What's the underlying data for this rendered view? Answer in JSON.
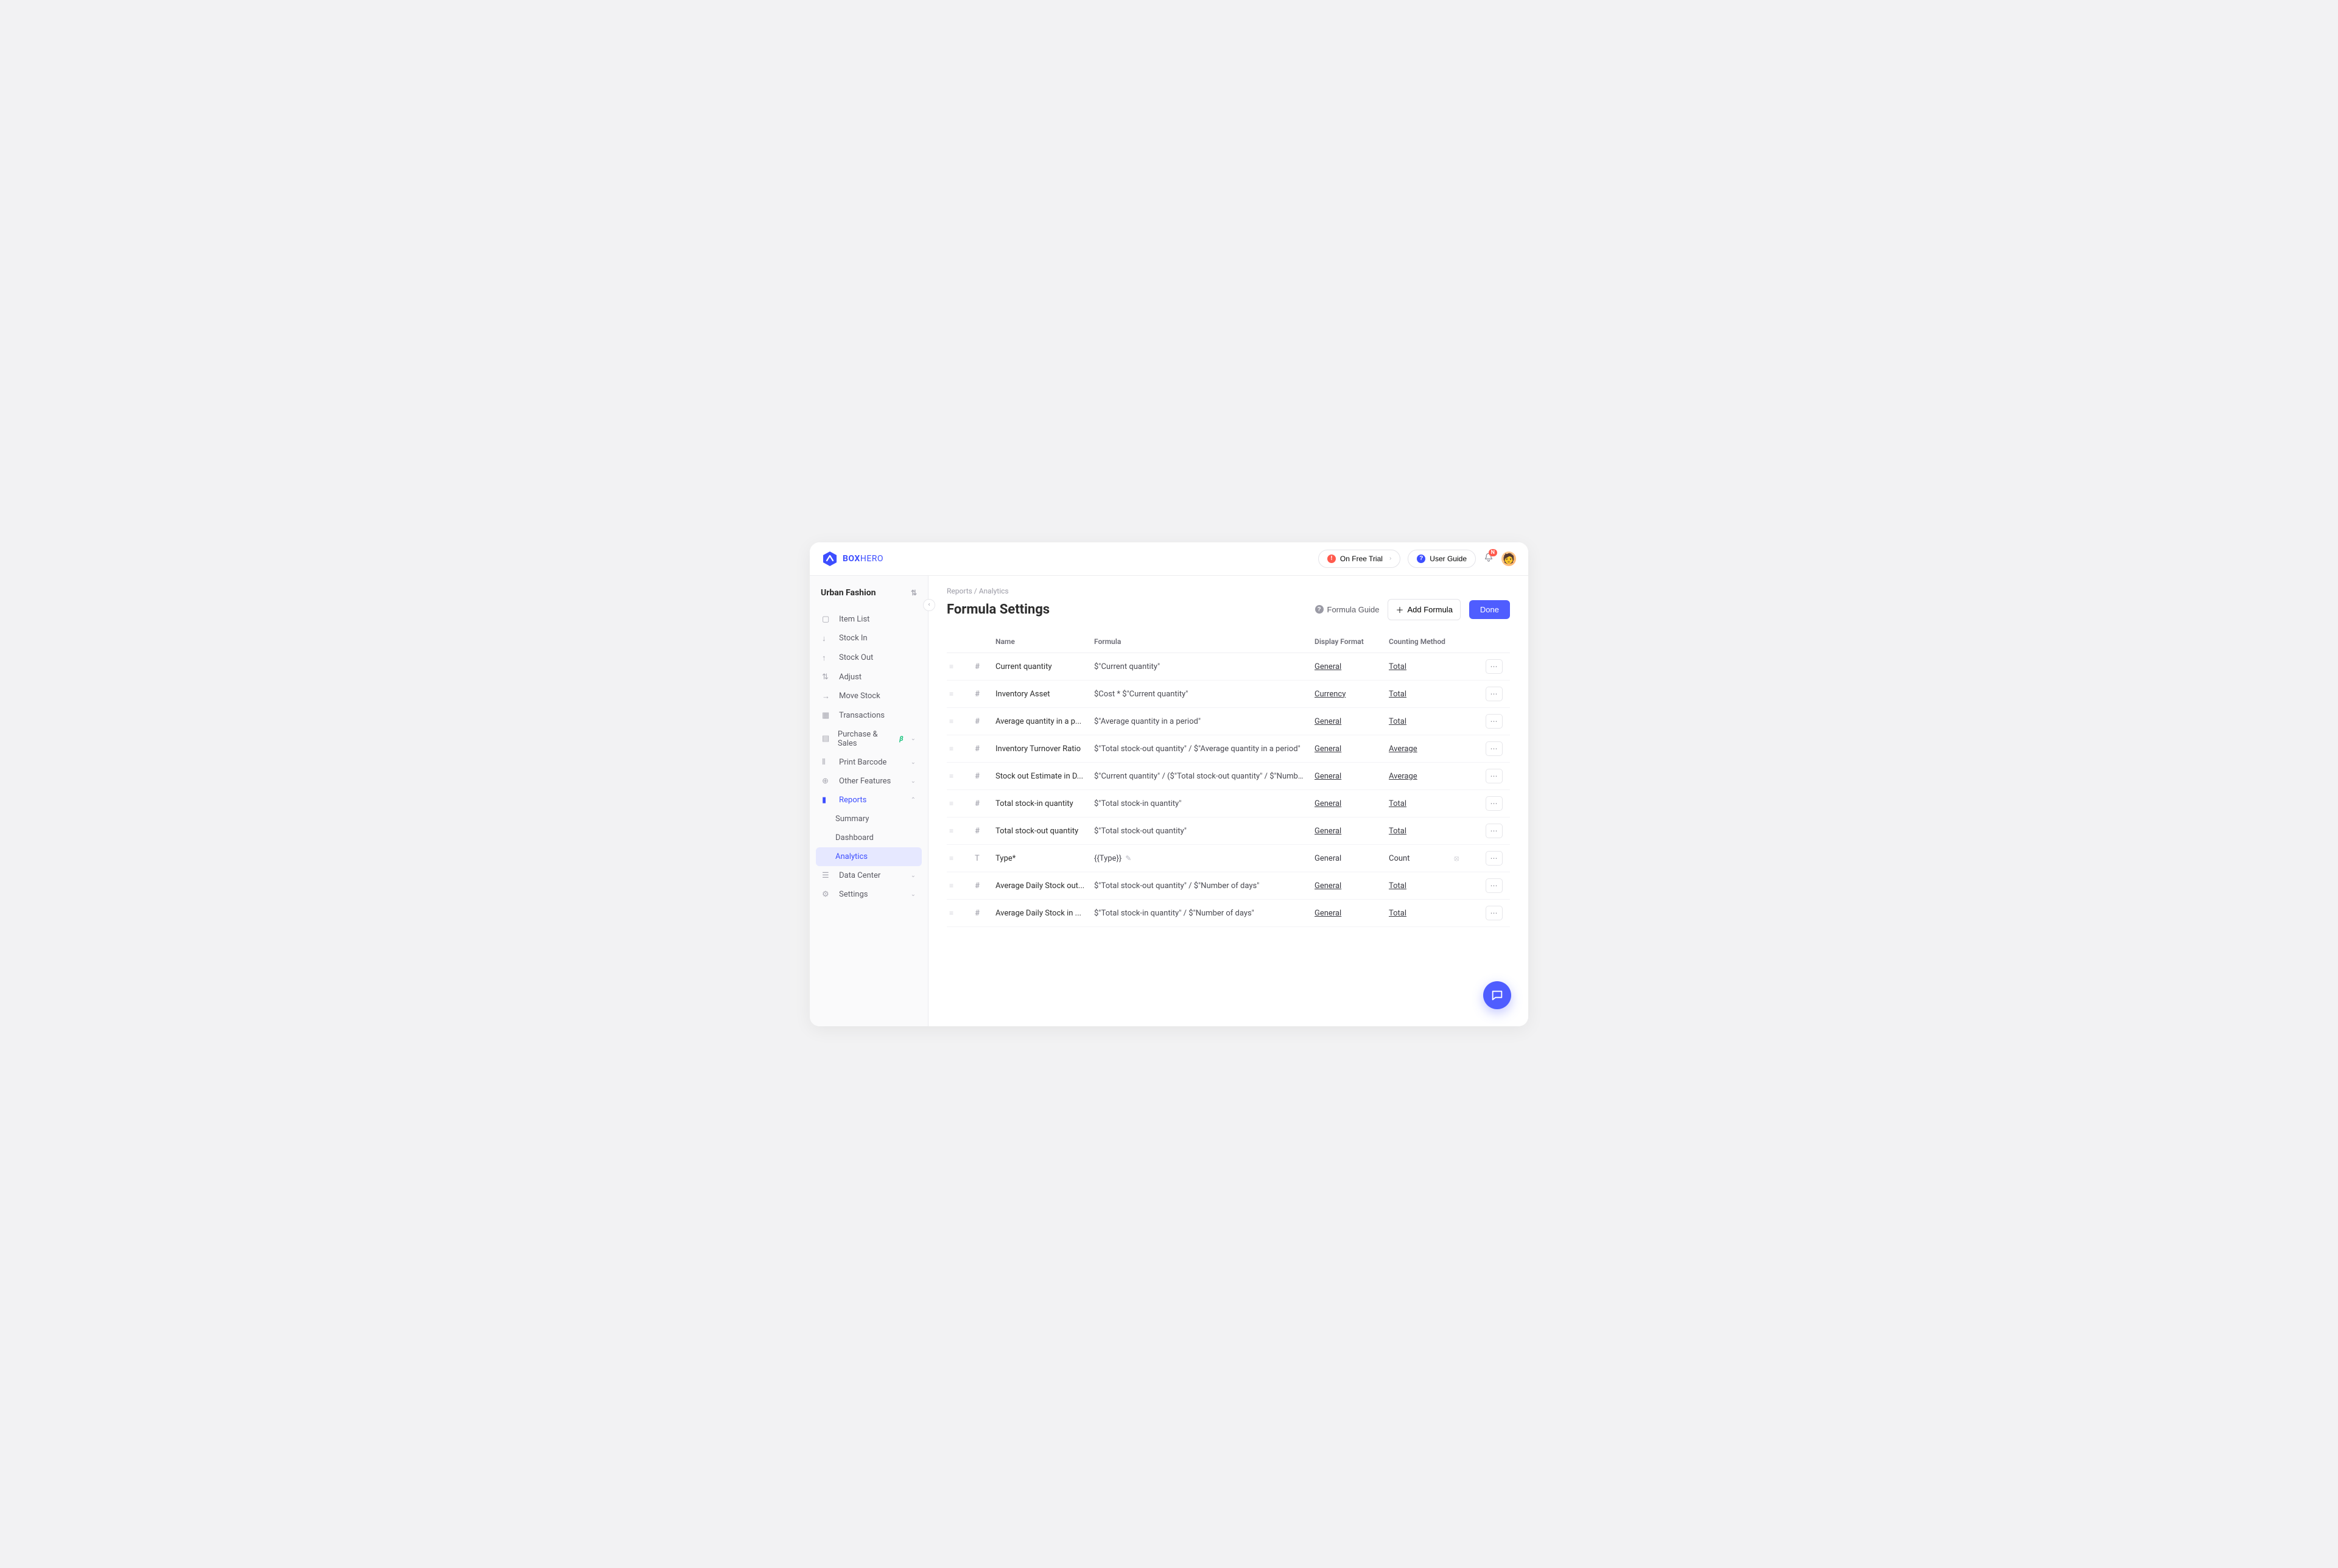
{
  "brand": {
    "bold": "BOX",
    "light": "HERO"
  },
  "topbar": {
    "trial_label": "On Free Trial",
    "guide_label": "User Guide",
    "notif_count": "N"
  },
  "team": {
    "name": "Urban Fashion"
  },
  "sidebar": {
    "items": [
      {
        "label": "Item List",
        "icon": "box"
      },
      {
        "label": "Stock In",
        "icon": "down"
      },
      {
        "label": "Stock Out",
        "icon": "up"
      },
      {
        "label": "Adjust",
        "icon": "swap"
      },
      {
        "label": "Move Stock",
        "icon": "arrow"
      },
      {
        "label": "Transactions",
        "icon": "receipt"
      },
      {
        "label": "Purchase & Sales",
        "icon": "doc",
        "beta": true,
        "expandable": true
      },
      {
        "label": "Print Barcode",
        "icon": "barcode",
        "expandable": true
      },
      {
        "label": "Other Features",
        "icon": "plus-circle",
        "expandable": true
      },
      {
        "label": "Reports",
        "icon": "chart",
        "highlight": true,
        "expanded": true
      },
      {
        "label": "Summary",
        "sub": true
      },
      {
        "label": "Dashboard",
        "sub": true
      },
      {
        "label": "Analytics",
        "sub": true,
        "active": true
      },
      {
        "label": "Data Center",
        "icon": "data",
        "expandable": true
      },
      {
        "label": "Settings",
        "icon": "gear",
        "expandable": true
      }
    ]
  },
  "breadcrumb": "Reports  /  Analytics",
  "page_title": "Formula Settings",
  "actions": {
    "guide": "Formula Guide",
    "add": "Add Formula",
    "done": "Done"
  },
  "columns": {
    "name": "Name",
    "formula": "Formula",
    "display": "Display Format",
    "counting": "Counting Method"
  },
  "rows": [
    {
      "type": "#",
      "name": "Current quantity",
      "formula": "$\"Current quantity\"",
      "display": "General",
      "display_link": true,
      "count": "Total",
      "count_link": true
    },
    {
      "type": "#",
      "name": "Inventory Asset",
      "formula": "$Cost * $\"Current quantity\"",
      "display": "Currency",
      "display_link": true,
      "count": "Total",
      "count_link": true
    },
    {
      "type": "#",
      "name": "Average quantity in a p...",
      "formula": "$\"Average quantity in a period\"",
      "display": "General",
      "display_link": true,
      "count": "Total",
      "count_link": true
    },
    {
      "type": "#",
      "name": "Inventory Turnover Ratio",
      "formula": "$\"Total stock-out quantity\" / $\"Average quantity in a period\"",
      "display": "General",
      "display_link": true,
      "count": "Average",
      "count_link": true
    },
    {
      "type": "#",
      "name": "Stock out Estimate in D...",
      "formula": "$\"Current quantity\" / ($\"Total stock-out quantity\" / $\"Number of day...",
      "display": "General",
      "display_link": true,
      "count": "Average",
      "count_link": true
    },
    {
      "type": "#",
      "name": "Total stock-in quantity",
      "formula": "$\"Total stock-in quantity\"",
      "display": "General",
      "display_link": true,
      "count": "Total",
      "count_link": true
    },
    {
      "type": "#",
      "name": "Total stock-out quantity",
      "formula": "$\"Total stock-out quantity\"",
      "display": "General",
      "display_link": true,
      "count": "Total",
      "count_link": true
    },
    {
      "type": "T",
      "name": "Type*",
      "formula": "{{Type}}",
      "editable": true,
      "display": "General",
      "display_link": false,
      "count": "Count",
      "count_link": false,
      "hidden": true
    },
    {
      "type": "#",
      "name": "Average Daily Stock out...",
      "formula": "$\"Total stock-out quantity\" / $\"Number of days\"",
      "display": "General",
      "display_link": true,
      "count": "Total",
      "count_link": true
    },
    {
      "type": "#",
      "name": "Average Daily Stock in ...",
      "formula": "$\"Total stock-in quantity\" / $\"Number of days\"",
      "display": "General",
      "display_link": true,
      "count": "Total",
      "count_link": true
    }
  ]
}
